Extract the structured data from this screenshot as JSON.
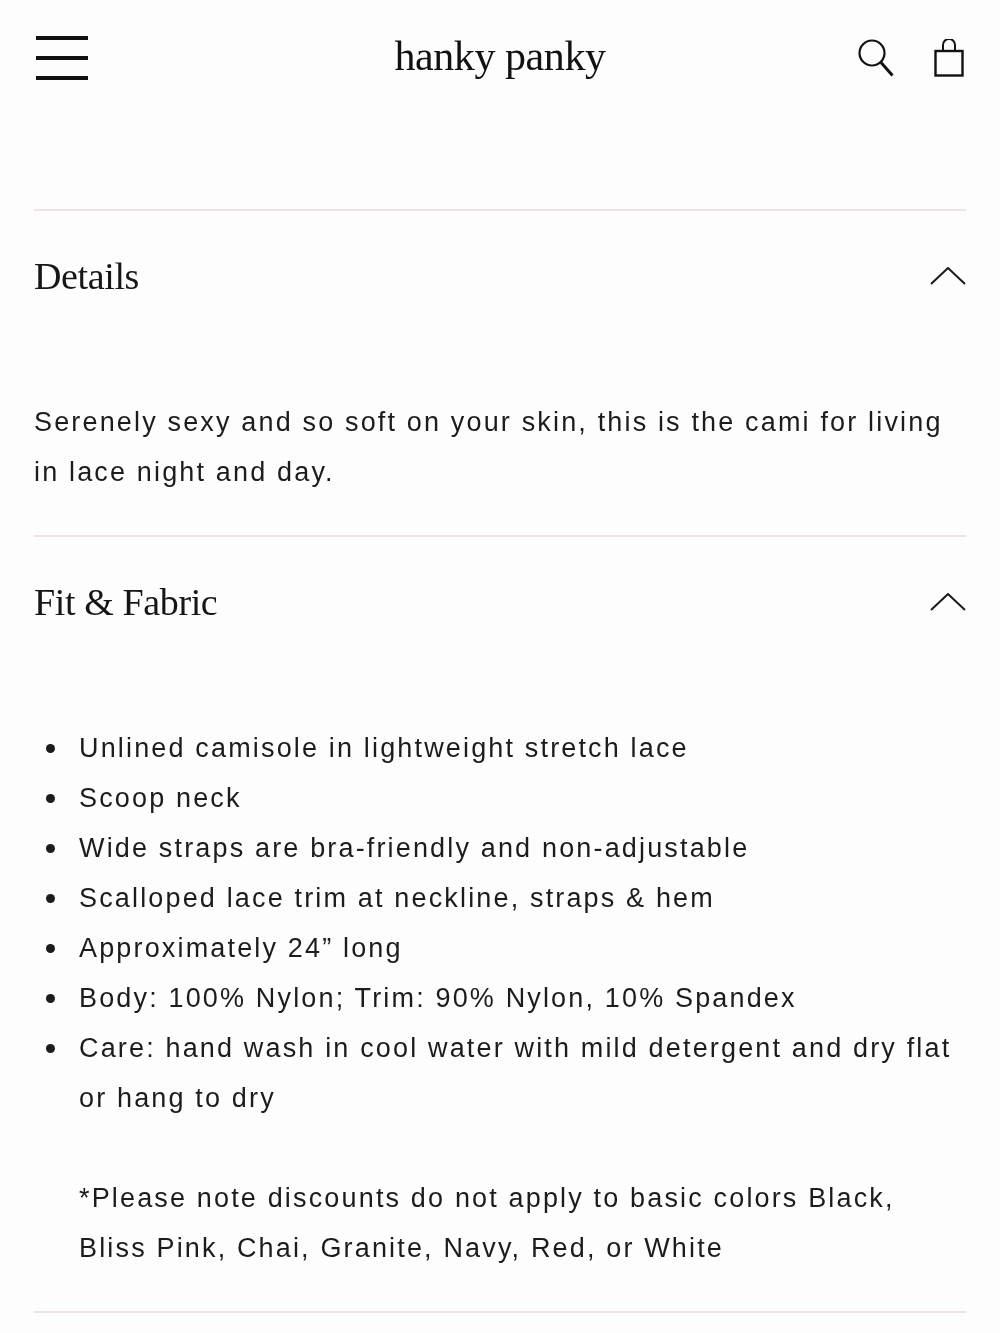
{
  "header": {
    "logo": "hanky panky"
  },
  "sections": [
    {
      "title": "Details",
      "expanded": true,
      "paragraph": "Serenely sexy and so soft on your skin, this is the cami for living in lace night and day."
    },
    {
      "title": "Fit & Fabric",
      "expanded": true,
      "bullets": [
        "Unlined camisole in lightweight stretch lace",
        "Scoop neck",
        "Wide straps are bra-friendly and non-adjustable",
        "Scalloped lace trim at neckline, straps & hem",
        "Approximately 24” long",
        "Body: 100% Nylon; Trim: 90% Nylon, 10% Spandex",
        "Care: hand wash in cool water with mild detergent and dry flat or hang to dry"
      ],
      "note": "*Please note discounts do not apply to basic colors Black, Bliss Pink, Chai, Granite, Navy, Red, or White"
    }
  ]
}
